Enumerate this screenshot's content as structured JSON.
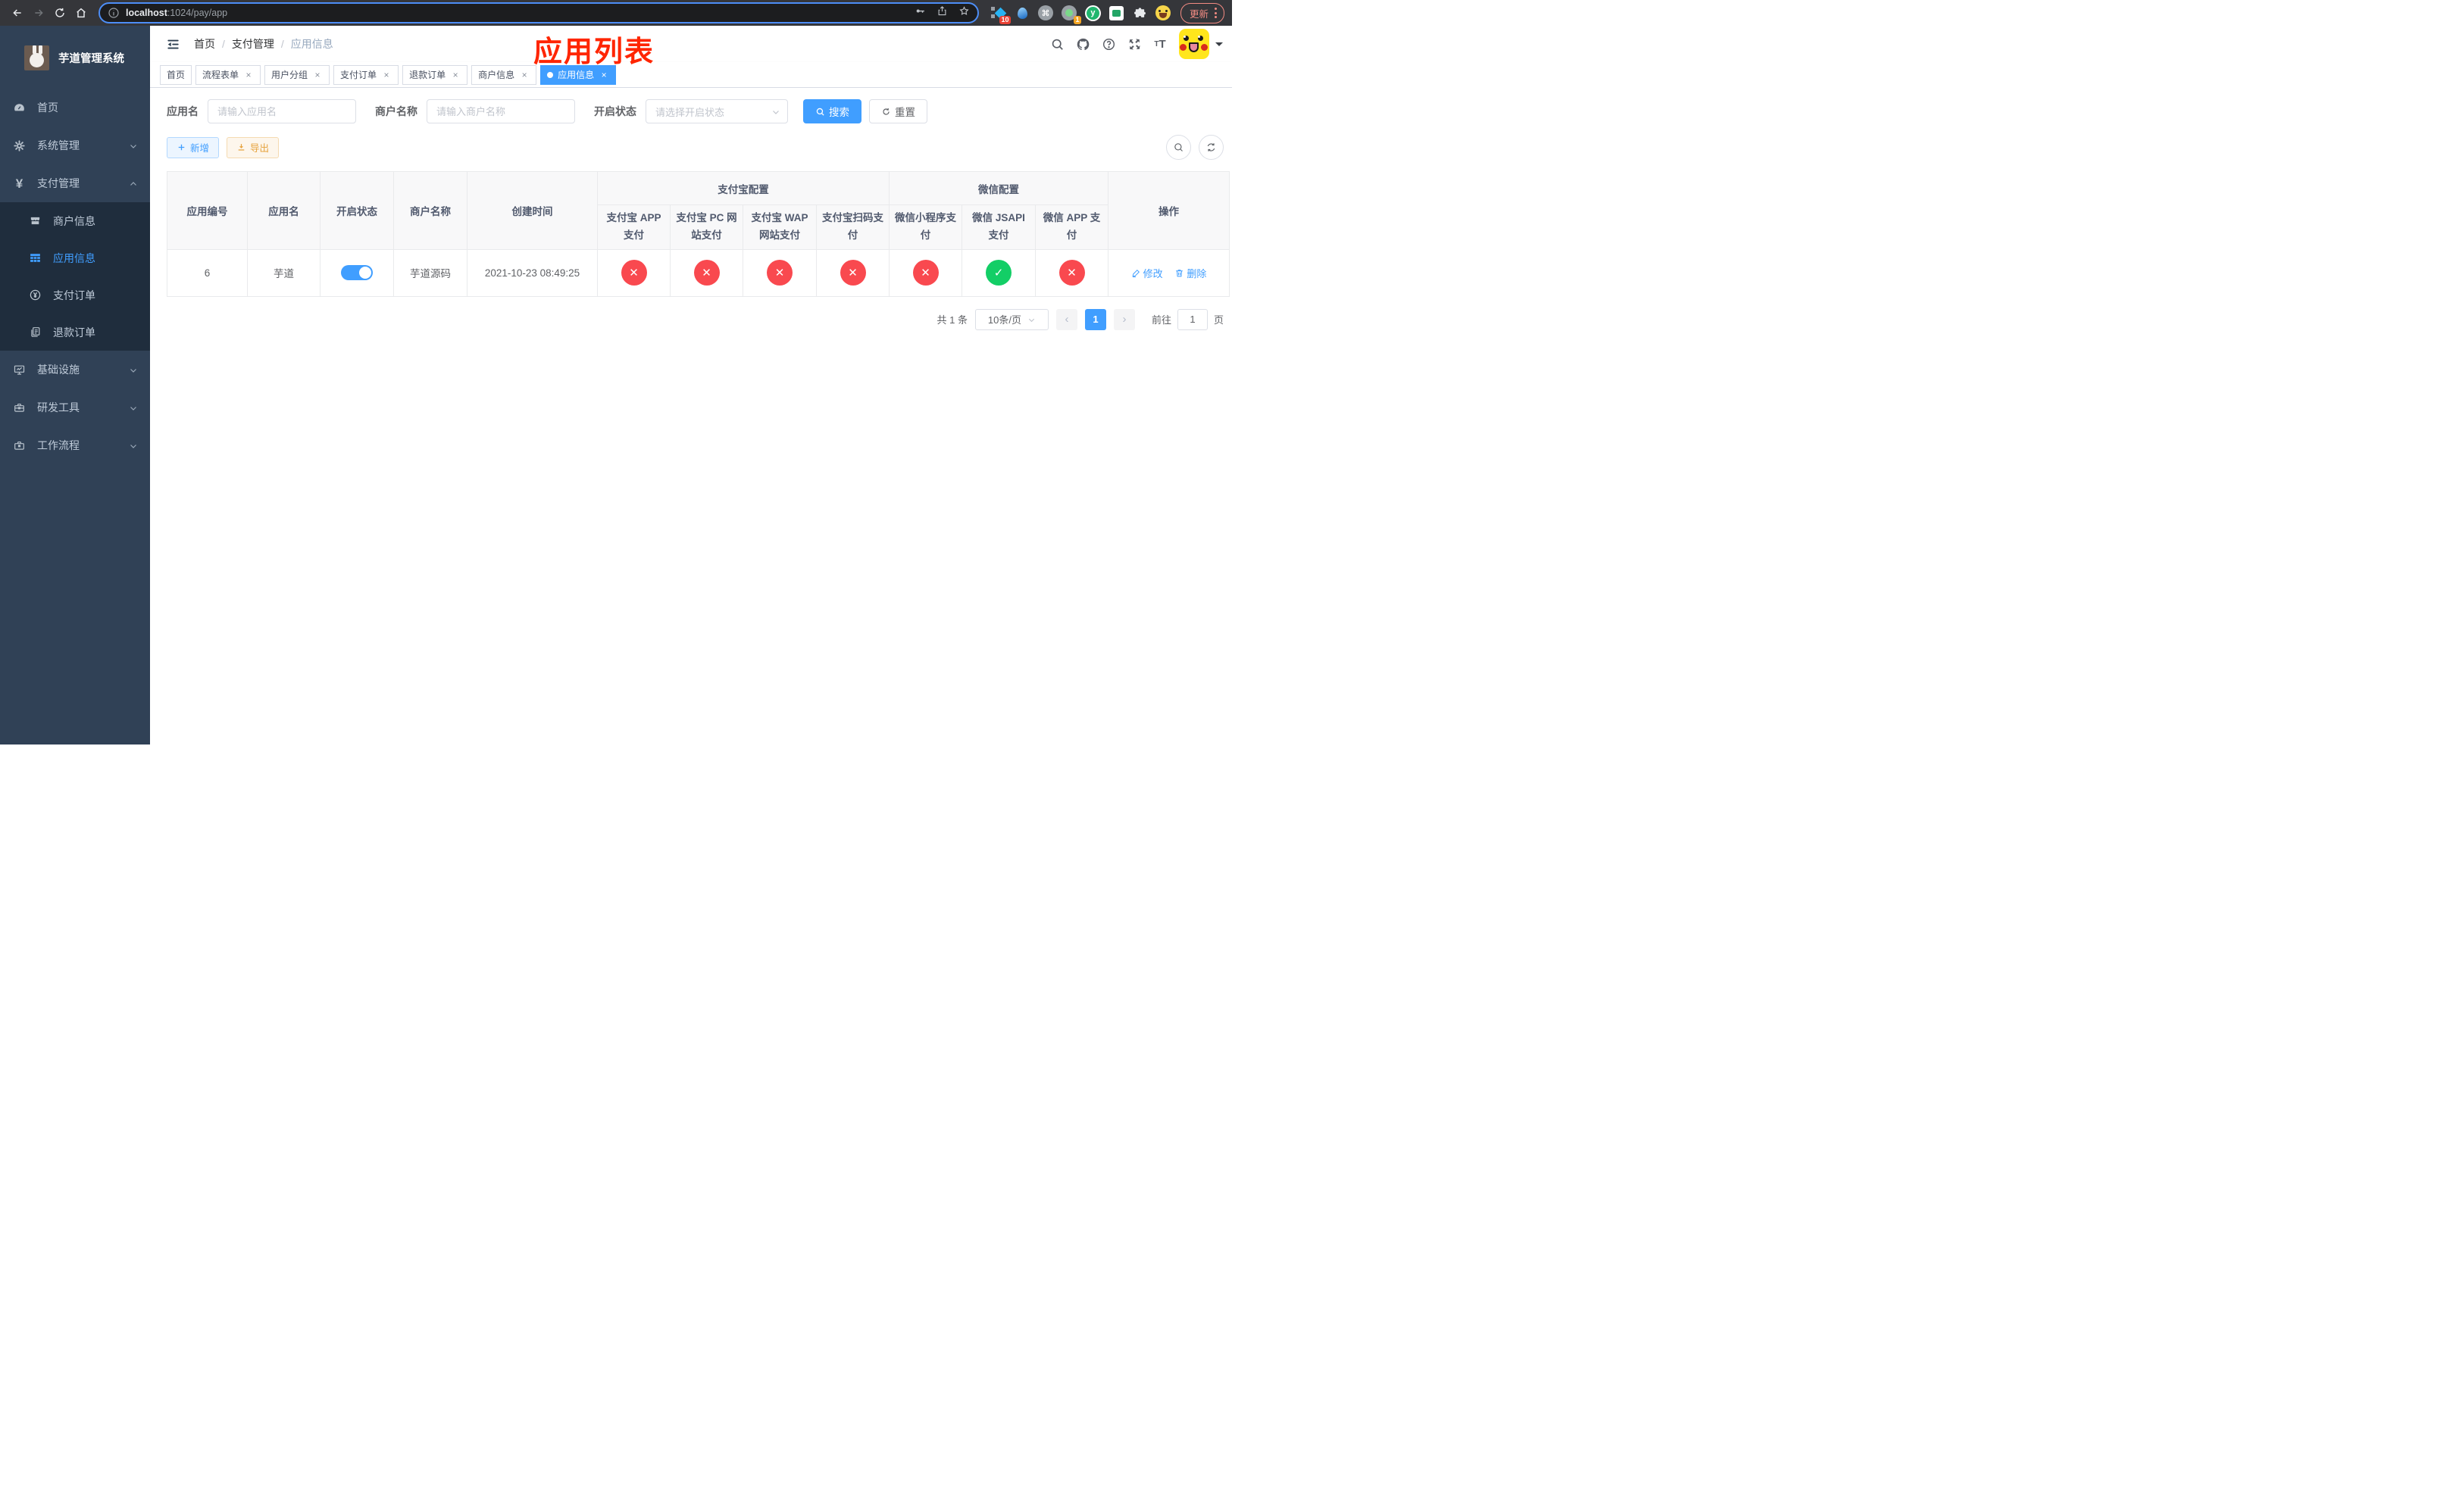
{
  "browser": {
    "url_host": "localhost",
    "url_path": ":1024/pay/app",
    "badge_pinned": "10",
    "badge_session": "1",
    "ext_letter": "y",
    "update_button": "更新"
  },
  "sidebar": {
    "title": "芋道管理系统",
    "menu": [
      {
        "label": "首页"
      },
      {
        "label": "系统管理"
      },
      {
        "label": "支付管理"
      },
      {
        "label": "基础设施"
      },
      {
        "label": "研发工具"
      },
      {
        "label": "工作流程"
      }
    ],
    "submenu": [
      {
        "label": "商户信息"
      },
      {
        "label": "应用信息"
      },
      {
        "label": "支付订单"
      },
      {
        "label": "退款订单"
      }
    ]
  },
  "header": {
    "breadcrumb": [
      "首页",
      "支付管理",
      "应用信息"
    ],
    "separator": "/"
  },
  "annotation": "应用列表",
  "tabs": {
    "close_glyph": "×",
    "items": [
      {
        "label": "首页"
      },
      {
        "label": "流程表单"
      },
      {
        "label": "用户分组"
      },
      {
        "label": "支付订单"
      },
      {
        "label": "退款订单"
      },
      {
        "label": "商户信息"
      },
      {
        "label": "应用信息"
      }
    ]
  },
  "filters": {
    "app_name_label": "应用名",
    "app_name_placeholder": "请输入应用名",
    "merchant_label": "商户名称",
    "merchant_placeholder": "请输入商户名称",
    "status_label": "开启状态",
    "status_placeholder": "请选择开启状态",
    "search_button": "搜索",
    "reset_button": "重置"
  },
  "toolbar": {
    "add_button": "新增",
    "export_button": "导出"
  },
  "table": {
    "headers": {
      "app_id": "应用编号",
      "app_name": "应用名",
      "status": "开启状态",
      "merchant": "商户名称",
      "created": "创建时间",
      "alipay_group": "支付宝配置",
      "wechat_group": "微信配置",
      "actions": "操作",
      "sub": [
        "支付宝 APP 支付",
        "支付宝 PC 网站支付",
        "支付宝 WAP 网站支付",
        "支付宝扫码支付",
        "微信小程序支付",
        "微信 JSAPI 支付",
        "微信 APP 支付"
      ]
    },
    "row": {
      "app_id": "6",
      "app_name": "芋道",
      "enabled": true,
      "merchant": "芋道源码",
      "created": "2021-10-23 08:49:25",
      "pay_statuses": [
        "fail",
        "fail",
        "fail",
        "fail",
        "fail",
        "success",
        "fail"
      ],
      "edit_action": "修改",
      "delete_action": "删除"
    }
  },
  "pagination": {
    "total": "共 1 条",
    "page_size": "10条/页",
    "prev_glyph": "‹",
    "current_page": "1",
    "next_glyph": "›",
    "goto_prefix": "前往",
    "goto_value": "1",
    "goto_suffix": "页"
  },
  "colors": {
    "accent": "#409eff",
    "success": "#13ce66",
    "danger": "#f9494f",
    "warning": "#e6a23c",
    "sidebar_bg": "#304156",
    "submenu_bg": "#1f2d3d",
    "annotation": "#ff2500"
  }
}
